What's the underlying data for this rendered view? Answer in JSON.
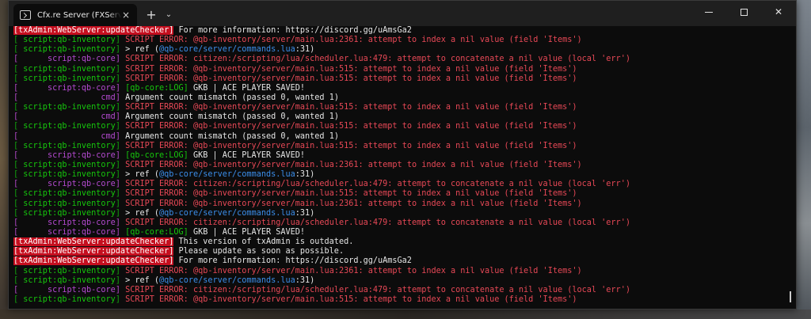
{
  "window": {
    "tab_title": "Cfx.re Server (FXServer/unknown)",
    "tab_close": "×",
    "new_tab": "+",
    "dropdown": "⌄",
    "close": "✕"
  },
  "console_lines": [
    {
      "kind": "tx",
      "tag": "[txAdmin:WebServer:updateChecker]",
      "msg": " For more information: https://discord.gg/uAmsGa2"
    },
    {
      "kind": "err",
      "brc": "g",
      "tag": " script:qb-inventory",
      "msg": " SCRIPT ERROR: @qb-inventory/server/main.lua:2361: attempt to index a nil value (field 'Items')"
    },
    {
      "kind": "ref",
      "brc": "g",
      "tag": " script:qb-inventory",
      "pre": " > ref (",
      "path": "@qb-core/server/commands.lua",
      "post": ":31)"
    },
    {
      "kind": "err",
      "brc": "p",
      "tag": "      script:qb-core",
      "msg": " SCRIPT ERROR: citizen:/scripting/lua/scheduler.lua:479: attempt to concatenate a nil value (local 'err')"
    },
    {
      "kind": "err",
      "brc": "g",
      "tag": " script:qb-inventory",
      "msg": " SCRIPT ERROR: @qb-inventory/server/main.lua:515: attempt to index a nil value (field 'Items')"
    },
    {
      "kind": "err",
      "brc": "g",
      "tag": " script:qb-inventory",
      "msg": " SCRIPT ERROR: @qb-inventory/server/main.lua:515: attempt to index a nil value (field 'Items')"
    },
    {
      "kind": "log",
      "brc": "p",
      "tag": "      script:qb-core",
      "log": " [qb-core:LOG]",
      "msg": " GKB | ACE PLAYER SAVED!"
    },
    {
      "kind": "txt",
      "brc": "p",
      "tag": "                 cmd",
      "msg": " Argument count mismatch (passed 0, wanted 1)"
    },
    {
      "kind": "err",
      "brc": "g",
      "tag": " script:qb-inventory",
      "msg": " SCRIPT ERROR: @qb-inventory/server/main.lua:515: attempt to index a nil value (field 'Items')"
    },
    {
      "kind": "txt",
      "brc": "p",
      "tag": "                 cmd",
      "msg": " Argument count mismatch (passed 0, wanted 1)"
    },
    {
      "kind": "err",
      "brc": "g",
      "tag": " script:qb-inventory",
      "msg": " SCRIPT ERROR: @qb-inventory/server/main.lua:515: attempt to index a nil value (field 'Items')"
    },
    {
      "kind": "txt",
      "brc": "p",
      "tag": "                 cmd",
      "msg": " Argument count mismatch (passed 0, wanted 1)"
    },
    {
      "kind": "err",
      "brc": "g",
      "tag": " script:qb-inventory",
      "msg": " SCRIPT ERROR: @qb-inventory/server/main.lua:515: attempt to index a nil value (field 'Items')"
    },
    {
      "kind": "log",
      "brc": "p",
      "tag": "      script:qb-core",
      "log": " [qb-core:LOG]",
      "msg": " GKB | ACE PLAYER SAVED!"
    },
    {
      "kind": "err",
      "brc": "g",
      "tag": " script:qb-inventory",
      "msg": " SCRIPT ERROR: @qb-inventory/server/main.lua:2361: attempt to index a nil value (field 'Items')"
    },
    {
      "kind": "ref",
      "brc": "g",
      "tag": " script:qb-inventory",
      "pre": " > ref (",
      "path": "@qb-core/server/commands.lua",
      "post": ":31)"
    },
    {
      "kind": "err",
      "brc": "p",
      "tag": "      script:qb-core",
      "msg": " SCRIPT ERROR: citizen:/scripting/lua/scheduler.lua:479: attempt to concatenate a nil value (local 'err')"
    },
    {
      "kind": "err",
      "brc": "g",
      "tag": " script:qb-inventory",
      "msg": " SCRIPT ERROR: @qb-inventory/server/main.lua:515: attempt to index a nil value (field 'Items')"
    },
    {
      "kind": "err",
      "brc": "g",
      "tag": " script:qb-inventory",
      "msg": " SCRIPT ERROR: @qb-inventory/server/main.lua:2361: attempt to index a nil value (field 'Items')"
    },
    {
      "kind": "ref",
      "brc": "g",
      "tag": " script:qb-inventory",
      "pre": " > ref (",
      "path": "@qb-core/server/commands.lua",
      "post": ":31)"
    },
    {
      "kind": "err",
      "brc": "p",
      "tag": "      script:qb-core",
      "msg": " SCRIPT ERROR: citizen:/scripting/lua/scheduler.lua:479: attempt to concatenate a nil value (local 'err')"
    },
    {
      "kind": "log",
      "brc": "p",
      "tag": "      script:qb-core",
      "log": " [qb-core:LOG]",
      "msg": " GKB | ACE PLAYER SAVED!"
    },
    {
      "kind": "tx",
      "tag": "[txAdmin:WebServer:updateChecker]",
      "msg": " This version of txAdmin is outdated."
    },
    {
      "kind": "tx",
      "tag": "[txAdmin:WebServer:updateChecker]",
      "msg": " Please update as soon as possible."
    },
    {
      "kind": "tx",
      "tag": "[txAdmin:WebServer:updateChecker]",
      "msg": " For more information: https://discord.gg/uAmsGa2"
    },
    {
      "kind": "err",
      "brc": "g",
      "tag": " script:qb-inventory",
      "msg": " SCRIPT ERROR: @qb-inventory/server/main.lua:2361: attempt to index a nil value (field 'Items')"
    },
    {
      "kind": "ref",
      "brc": "g",
      "tag": " script:qb-inventory",
      "pre": " > ref (",
      "path": "@qb-core/server/commands.lua",
      "post": ":31)"
    },
    {
      "kind": "err",
      "brc": "p",
      "tag": "      script:qb-core",
      "msg": " SCRIPT ERROR: citizen:/scripting/lua/scheduler.lua:479: attempt to concatenate a nil value (local 'err')"
    },
    {
      "kind": "err",
      "brc": "g",
      "tag": " script:qb-inventory",
      "msg": " SCRIPT ERROR: @qb-inventory/server/main.lua:515: attempt to index a nil value (field 'Items')"
    }
  ],
  "colors": {
    "terminal_bg": "#0c0c0c",
    "titlebar_bg": "#1f1f1f",
    "error": "#e74856",
    "bracket_green": "#13a10e",
    "tag_purple": "#b44ad0",
    "path_blue": "#3b8eea",
    "txadmin_bg": "#c50f1f"
  },
  "icons": {
    "tab": "terminal-icon",
    "min": "minimize-icon",
    "max": "maximize-icon",
    "close": "close-icon"
  }
}
